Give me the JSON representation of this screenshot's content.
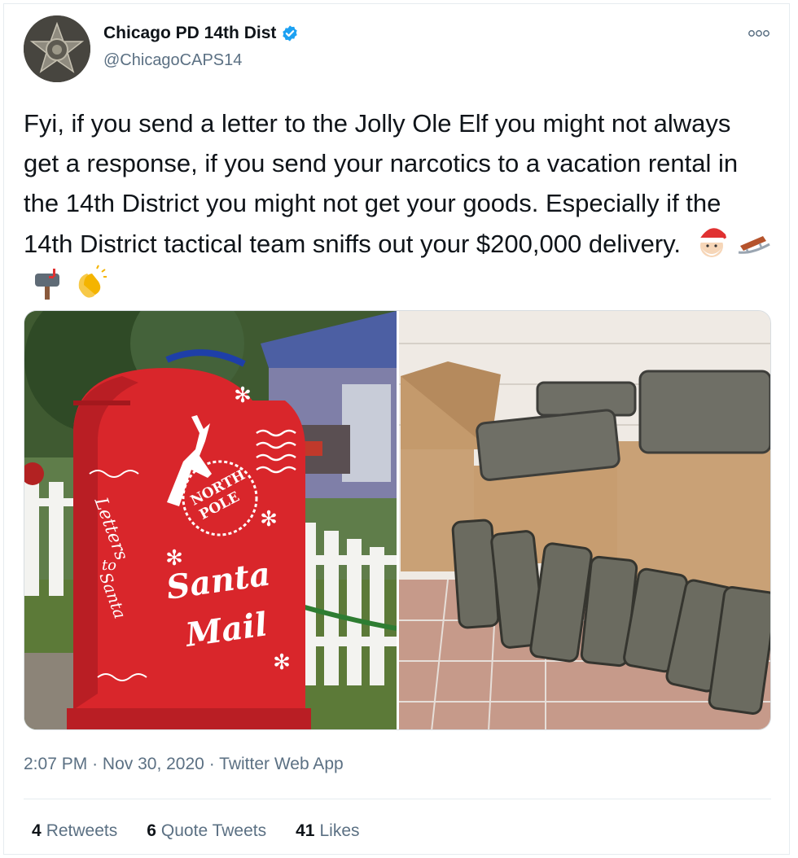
{
  "tweet": {
    "display_name": "Chicago PD 14th Dist",
    "handle": "@ChicagoCAPS14",
    "text": "Fyi, if you send a letter to the Jolly Ole Elf you might not always get a response, if you send your narcotics to a vacation rental in the 14th District you might not get your goods. Especially if the 14th District tactical team sniffs out your $200,000 delivery.",
    "emojis": [
      "santa-emoji",
      "sled-emoji",
      "mailbox-emoji",
      "clapping-hands-emoji"
    ],
    "time": "2:07 PM",
    "date": "Nov 30, 2020",
    "source": "Twitter Web App",
    "sep": "·"
  },
  "image_left": {
    "mailbox_north": "NORTH",
    "mailbox_pole": "POLE",
    "mailbox_letters": "Letters",
    "mailbox_to": "to",
    "mailbox_santa_small": "Santa",
    "mailbox_santa": "Santa",
    "mailbox_mail": "Mail"
  },
  "stats": {
    "retweets_count": "4",
    "retweets_label": "Retweets",
    "quotes_count": "6",
    "quotes_label": "Quote Tweets",
    "likes_count": "41",
    "likes_label": "Likes"
  },
  "colors": {
    "verified": "#1da1f2",
    "mailbox_red": "#d9262b",
    "secondary_text": "#5b7083"
  }
}
